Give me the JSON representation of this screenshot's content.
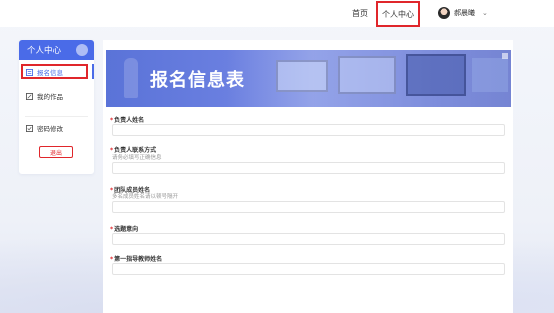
{
  "nav": {
    "home": "首页",
    "center": "个人中心",
    "user_name": "郝晨曦"
  },
  "sidebar": {
    "title": "个人中心",
    "items": [
      {
        "label": "报名信息",
        "icon": "form-icon"
      },
      {
        "label": "我的作品",
        "icon": "works-icon"
      },
      {
        "label": "密码修改",
        "icon": "edit-icon"
      }
    ],
    "logout": "退出"
  },
  "banner": {
    "title": "报名信息表"
  },
  "form": {
    "fields": [
      {
        "label": "负责人姓名",
        "hint": ""
      },
      {
        "label": "负责人联系方式",
        "hint": "请务必填写正确信息"
      },
      {
        "label": "团队成员姓名",
        "hint": "多名成员姓名请以顿号隔开"
      },
      {
        "label": "选题意向",
        "hint": ""
      },
      {
        "label": "第一指导教师姓名",
        "hint": ""
      }
    ]
  },
  "colors": {
    "accent": "#4a6be8",
    "highlight": "#e0262b"
  }
}
